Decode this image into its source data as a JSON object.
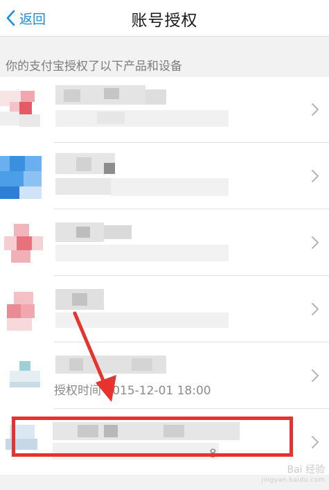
{
  "navbar": {
    "back_label": "返回",
    "title": "账号授权"
  },
  "section": {
    "header": "你的支付宝授权了以下产品和设备"
  },
  "rows": [
    {
      "label": ""
    },
    {
      "label": ""
    },
    {
      "label": ""
    },
    {
      "label": ""
    },
    {
      "label": "授权时间 2015-12-01 18:00"
    },
    {
      "label": "8"
    }
  ],
  "colors": {
    "accent": "#108ee9",
    "highlight": "#e8322d"
  },
  "watermark": {
    "text": "Bai 经验",
    "url": "jingyan.baidu.com"
  }
}
